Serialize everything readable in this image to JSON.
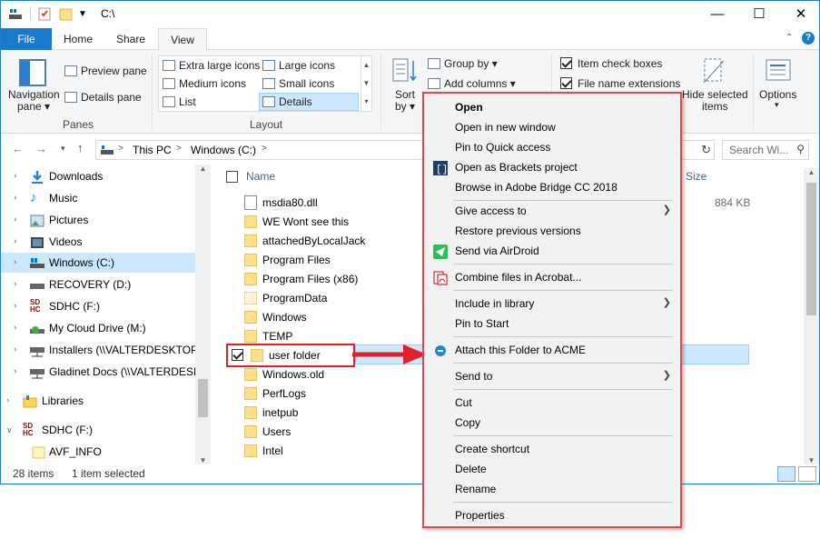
{
  "window": {
    "title": "C:\\"
  },
  "titlebar": {
    "minimize": "—",
    "maximize": "☐",
    "close": "✕"
  },
  "ribbon_tabs": [
    "File",
    "Home",
    "Share",
    "View"
  ],
  "ribbon": {
    "panes": {
      "nav_pane": "Navigation\npane",
      "nav_line1": "Navigation",
      "nav_line2": "pane ▾",
      "preview_pane": "Preview pane",
      "details_pane": "Details pane",
      "label": "Panes"
    },
    "layout": {
      "items": [
        "Extra large icons",
        "Large icons",
        "Medium icons",
        "Small icons",
        "List",
        "Details"
      ],
      "label": "Layout"
    },
    "current_view": {
      "sort_by_1": "Sort",
      "sort_by_2": "by ▾",
      "group_by": "Group by ▾",
      "add_columns": "Add columns ▾"
    },
    "show_hide": {
      "item_check_boxes": "Item check boxes",
      "file_name_extensions": "File name extensions",
      "hide_1": "Hide selected",
      "hide_2": "items"
    },
    "options": {
      "label": "Options",
      "arrow": "▾"
    }
  },
  "address": {
    "crumbs": [
      "This PC",
      "Windows (C:)"
    ],
    "separator": ">",
    "search_placeholder": "Search Wi..."
  },
  "nav_items": [
    {
      "label": "Downloads"
    },
    {
      "label": "Music"
    },
    {
      "label": "Pictures"
    },
    {
      "label": "Videos"
    },
    {
      "label": "Windows (C:)"
    },
    {
      "label": "RECOVERY (D:)"
    },
    {
      "label": "SDHC (F:)"
    },
    {
      "label": "My Cloud Drive (M:)"
    },
    {
      "label": "Installers (\\\\VALTERDESKTOP) ("
    },
    {
      "label": "Gladinet Docs (\\\\VALTERDESKT"
    },
    {
      "label": "Libraries"
    },
    {
      "label": "SDHC (F:)"
    },
    {
      "label": "AVF_INFO"
    }
  ],
  "columns": {
    "name": "Name",
    "size": "Size"
  },
  "files": [
    {
      "name": "msdia80.dll",
      "size": "884 KB"
    },
    {
      "name": "WE Wont see this",
      "size": ""
    },
    {
      "name": "attachedByLocalJack",
      "size": ""
    },
    {
      "name": "Program Files",
      "size": ""
    },
    {
      "name": "Program Files (x86)",
      "size": ""
    },
    {
      "name": "ProgramData",
      "size": ""
    },
    {
      "name": "Windows",
      "size": ""
    },
    {
      "name": "TEMP",
      "size": ""
    },
    {
      "name": "user folder",
      "size": ""
    },
    {
      "name": "Windows.old",
      "size": ""
    },
    {
      "name": "PerfLogs",
      "size": ""
    },
    {
      "name": "inetpub",
      "size": ""
    },
    {
      "name": "Users",
      "size": ""
    },
    {
      "name": "Intel",
      "size": ""
    }
  ],
  "status": {
    "count": "28 items",
    "selected": "1 item selected"
  },
  "context_menu": {
    "open": "Open",
    "open_new_window": "Open in new window",
    "pin_quick_access": "Pin to Quick access",
    "open_brackets": "Open as Brackets project",
    "browse_bridge": "Browse in Adobe Bridge CC 2018",
    "give_access": "Give access to",
    "restore_versions": "Restore previous versions",
    "send_airdroid": "Send via AirDroid",
    "combine_acrobat": "Combine files in Acrobat...",
    "include_library": "Include in library",
    "pin_start": "Pin to Start",
    "attach_acme": "Attach this Folder to ACME",
    "send_to": "Send to",
    "cut": "Cut",
    "copy": "Copy",
    "create_shortcut": "Create shortcut",
    "delete": "Delete",
    "rename": "Rename",
    "properties": "Properties"
  },
  "colors": {
    "accent": "#1979ca",
    "highlight_border": "#e8464e",
    "arrow": "#e0202a",
    "selection": "#cce8ff"
  }
}
